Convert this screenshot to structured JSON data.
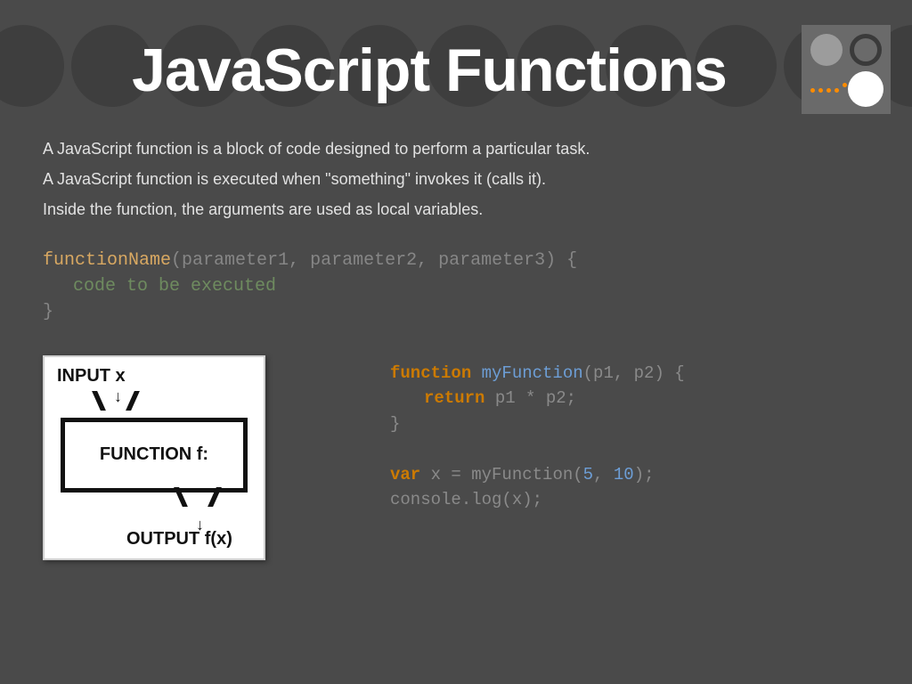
{
  "title": "JavaScript Functions",
  "body": {
    "p1": "A JavaScript function is a block of code designed to perform a particular task.",
    "p2": "A JavaScript function is executed when \"something\" invokes it (calls it).",
    "p3": "Inside the function, the arguments are used as local variables."
  },
  "syntax": {
    "fn_name": "functionName",
    "open": "(",
    "param1": "parameter1",
    "c1": ", ",
    "param2": "parameter2",
    "c2": ", ",
    "param3": "parameter3",
    "close_open_brace": ") {",
    "body": "code to be executed",
    "close_brace": "}"
  },
  "diagram": {
    "input": "INPUT x",
    "box": "FUNCTION f:",
    "output": "OUTPUT f(x)",
    "arrow_down": "↓"
  },
  "example": {
    "l1_kw": "function",
    "l1_id": " myFunction",
    "l1_rest": "(p1, p2) {",
    "l2_kw": "return",
    "l2_rest": " p1 * p2;",
    "l3": "}",
    "blank": "",
    "l4_kw": "var",
    "l4_rest1": " x = myFunction(",
    "l4_n1": "5",
    "l4_c": ", ",
    "l4_n2": "10",
    "l4_rest2": ");",
    "l5": "console.log(x);"
  }
}
